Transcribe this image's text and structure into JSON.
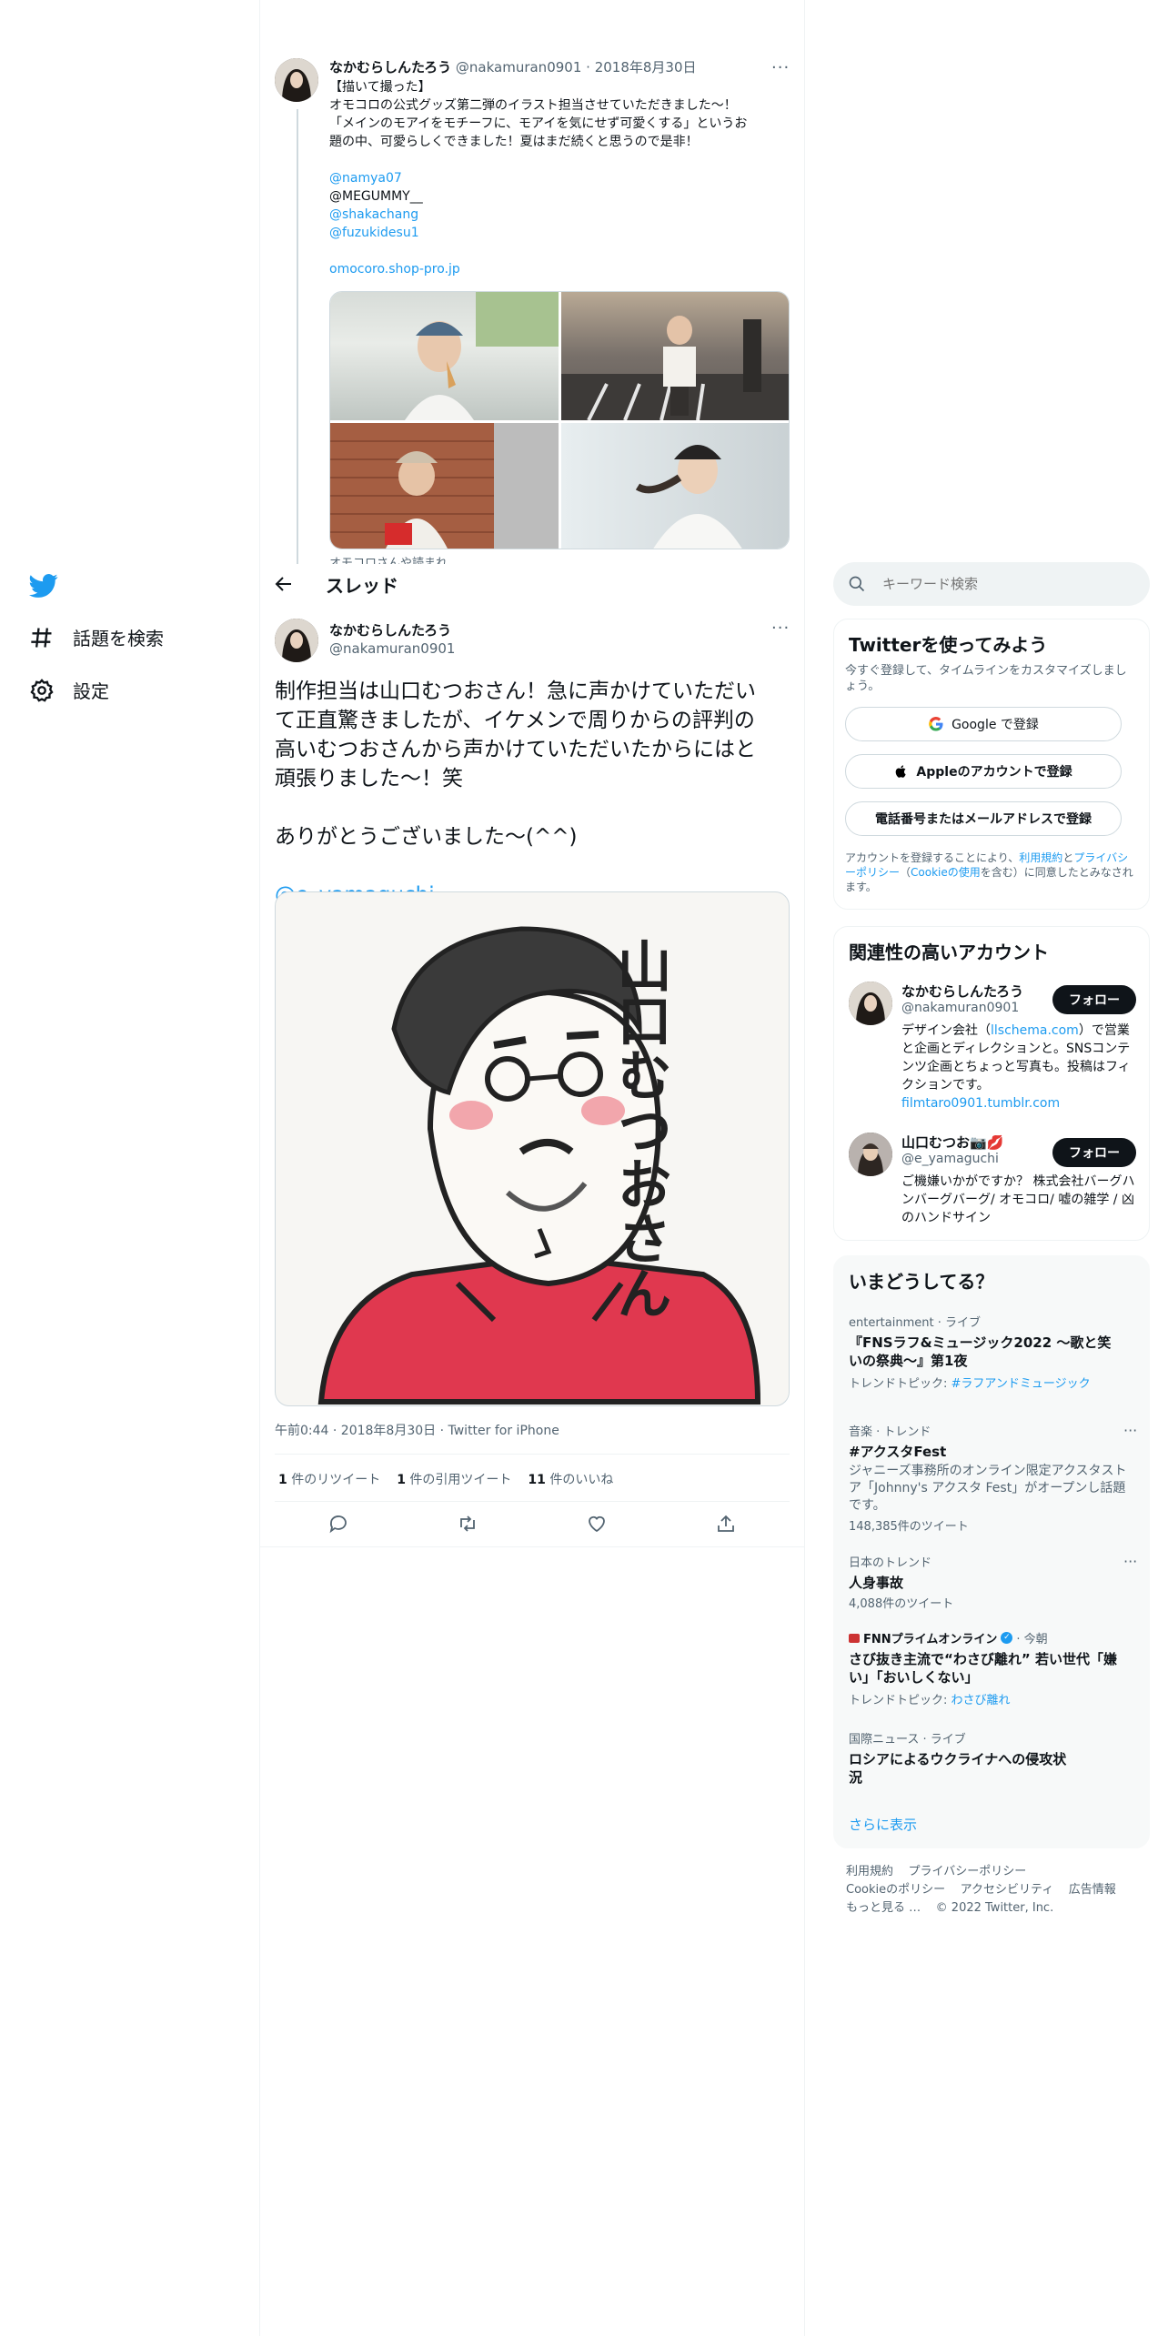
{
  "nav": {
    "explore_label": "話題を検索",
    "settings_label": "設定"
  },
  "header": {
    "back_icon": "arrow-left-icon",
    "title": "スレッド"
  },
  "parent_tweet": {
    "display_name": "なかむらしんたろう",
    "handle": "@nakamuran0901",
    "date": "2018年8月30日",
    "lines": [
      "【描いて撮った】",
      "オモコロの公式グッズ第二弾のイラスト担当させていただきました〜！",
      "「メインのモアイをモチーフに、モアイを気にせず可愛くする」というお",
      "題の中、可愛らしくできました！夏はまだ続くと思うので是非！"
    ],
    "mentions": [
      "@namya07",
      "@MEGUMMY__",
      "@shakachang",
      "@fuzukidesu1"
    ],
    "link": "omocoro.shop-pro.jp",
    "cut_text": "オモコロさんや読まれ"
  },
  "main_tweet": {
    "display_name": "なかむらしんたろう",
    "handle": "@nakamuran0901",
    "text_lines": [
      "制作担当は山口むつおさん！急に声かけていただい",
      "て正直驚きましたが、イケメンで周りからの評判の",
      "高いむつおさんから声かけていただいたからにはと",
      "頑張りました〜！笑"
    ],
    "text_line2": "ありがとうございました〜(^^)",
    "mention": "@e_yamaguchi",
    "illustration_text": "山口むつおさん",
    "timestamp": "午前0:44 · 2018年8月30日 · Twitter for iPhone",
    "stats": [
      {
        "count": "1",
        "label": "件のリツイート"
      },
      {
        "count": "1",
        "label": "件の引用ツイート"
      },
      {
        "count": "11",
        "label": "件のいいね"
      }
    ]
  },
  "search": {
    "placeholder": "キーワード検索"
  },
  "signup": {
    "title": "Twitterを使ってみよう",
    "subtitle": "今すぐ登録して、タイムラインをカスタマイズしましょう。",
    "google": "Google で登録",
    "apple": "Appleのアカウントで登録",
    "phone": "電話番号またはメールアドレスで登録",
    "legal_1": "アカウントを登録することにより、",
    "terms": "利用規約",
    "legal_2": "と",
    "privacy": "プライバシーポリシー",
    "legal_3": "（",
    "cookie": "Cookieの使用",
    "legal_4": "を含む）に同意したとみなされます。"
  },
  "related": {
    "title": "関連性の高いアカウント",
    "follow_label": "フォロー",
    "accounts": [
      {
        "name": "なかむらしんたろう",
        "handle": "@nakamuran0901",
        "bio_1": "デザイン会社（",
        "bio_link": "llschema.com",
        "bio_2": "）で営業と企画とディレクションと。SNSコンテンツ企画とちょっと写真も。投稿はフィクションです。",
        "url": "filmtaro0901.tumblr.com"
      },
      {
        "name": "山口むつお",
        "name_emoji": "📷💋",
        "handle": "@e_yamaguchi",
        "bio": "ご機嫌いかがですか？ 株式会社バーグハンバーグバーグ/ オモコロ/ 嘘の雑学 / 凶のハンドサイン"
      }
    ]
  },
  "trends": {
    "title": "いまどうしてる？",
    "items": [
      {
        "meta": "entertainment · ライブ",
        "title": "『FNSラフ&ミュージック2022 〜歌と笑いの祭典〜』第1夜",
        "topic_label": "トレンドトピック: ",
        "topic": "#ラフアンドミュージック"
      },
      {
        "meta": "音楽 · トレンド",
        "title": "#アクスタFest",
        "desc": "ジャニーズ事務所のオンライン限定アクスタストア「Johnny's アクスタ Fest」がオープンし話題です。",
        "count": "148,385件のツイート"
      },
      {
        "meta": "日本のトレンド",
        "title": "人身事故",
        "count": "4,088件のツイート"
      },
      {
        "source": "FNNプライムオンライン",
        "time": " · 今朝",
        "title": "さび抜き主流で“わさび離れ” 若い世代「嫌い」「おいしくない」",
        "topic_label": "トレンドトピック: ",
        "topic": "わさび離れ"
      },
      {
        "meta": "国際ニュース · ライブ",
        "title": "ロシアによるウクライナへの侵攻状況"
      }
    ],
    "more": "さらに表示"
  },
  "footer": {
    "links": [
      "利用規約",
      "プライバシーポリシー",
      "Cookieのポリシー",
      "アクセシビリティ",
      "広告情報",
      "もっと見る …"
    ],
    "copyright": "© 2022 Twitter, Inc."
  },
  "colors": {
    "accent": "#1d9bf0",
    "text": "#0f1419",
    "muted": "#536471"
  }
}
